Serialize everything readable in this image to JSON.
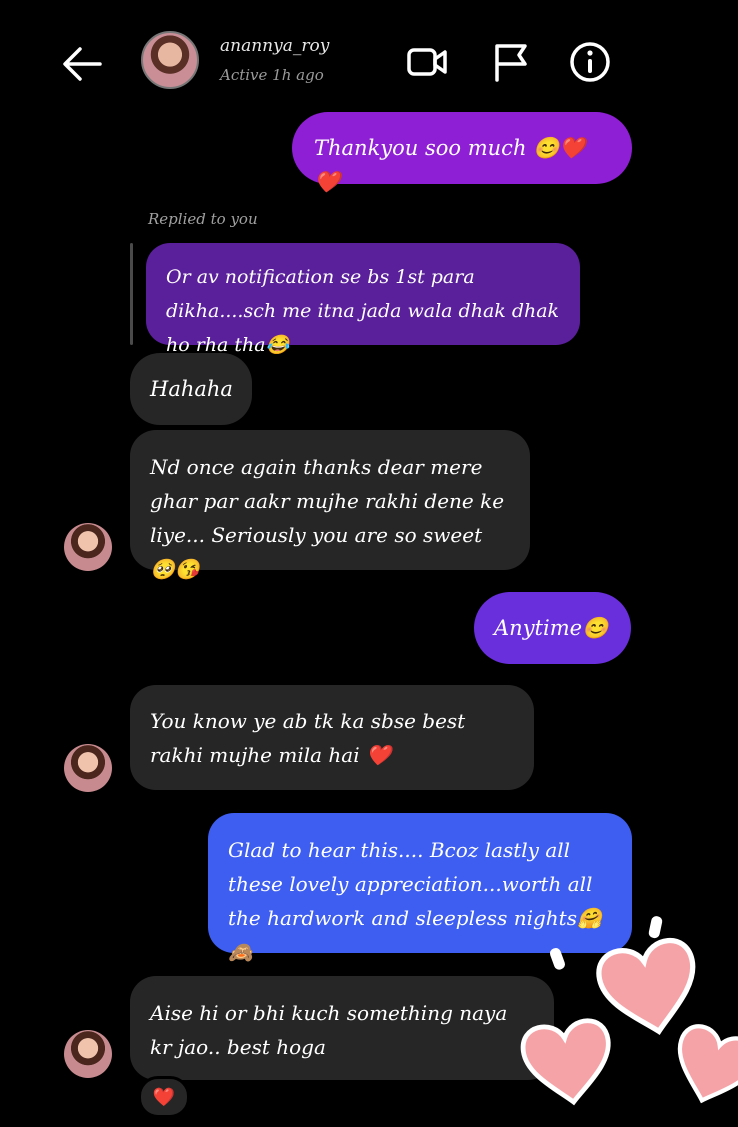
{
  "header": {
    "username": "anannya_roy",
    "status": "Active 1h ago"
  },
  "messages": {
    "m1": "Thankyou soo much 😊❤️❤️",
    "replied_label": "Replied to you",
    "m2": "Or av notification se bs 1st para dikha....sch me itna jada wala dhak dhak ho rha tha😂",
    "m3": "Hahaha",
    "m4": "Nd once again thanks dear mere ghar par aakr mujhe rakhi dene ke liye... Seriously you are so sweet 🥺😘",
    "m5": "Anytime😊",
    "m6": "You know ye ab tk ka sbse best rakhi mujhe mila hai ❤️",
    "m7": "Glad to hear this.... Bcoz lastly all these lovely appreciation...worth all the hardwork and sleepless nights🤗🙈",
    "m8": "Aise hi or bhi kuch something naya kr jao.. best hoga",
    "reaction": "❤️"
  },
  "colors": {
    "sent_purple": "#8f1fd4",
    "sent_violet": "#6a2fdc",
    "sent_blue": "#3d5ef0",
    "received": "#262626",
    "sticker_heart": "#f6a3a8"
  }
}
